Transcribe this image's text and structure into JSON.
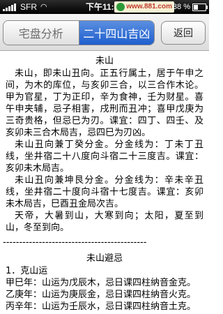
{
  "status_bar": {
    "carrier": "SFR",
    "time": "下午11:42",
    "logo_text": "www.881.com",
    "battery": "38 %"
  },
  "toolbar": {
    "tabs": [
      {
        "label": "宅盘分析",
        "active": false
      },
      {
        "label": "二十四山吉凶",
        "active": true
      }
    ],
    "back_label": "返回"
  },
  "content": {
    "title": "未山",
    "paragraphs": [
      "未山，即未山丑向。正五行属土，居于午申之间，为木的库位，与亥卯三合，以三合作木论。甲为官星，丁为正印，辛为食神，壬为财星。喜午申夹辅，忌子相害，戌刑而丑冲；喜甲戊庚为三奇贵格，但忌巳为刃。课宜：四丁、四壬、及亥卯未三合木局吉，忌四巳为刃凶。",
      "未山丑向兼丁癸分金。分金线为：丁未丁丑线，坐井宿二十八度向斗宿二十三度吉。课宜：亥卯未木局吉。",
      "未山丑向兼坤艮分金。分金线为：辛未辛丑线，坐井宿二十度向斗宿十七度吉。课宜：亥卯未木局吉，巳酉丑金局次吉。",
      "天帝，大暑到山，大寒到向；太阳，夏至到山，冬至到向。"
    ],
    "divider": "--------------------------------------------",
    "section_title": "未山避忌",
    "section_heading": "1．克山运",
    "lines": [
      "甲巳年：山运为戊辰木，忌日课四柱纳音金克。",
      "乙庚年：山运为庚辰金，忌日课四柱纳音火克。",
      "丙辛年：山运为壬辰水，忌日课四柱纳音土克。"
    ]
  }
}
